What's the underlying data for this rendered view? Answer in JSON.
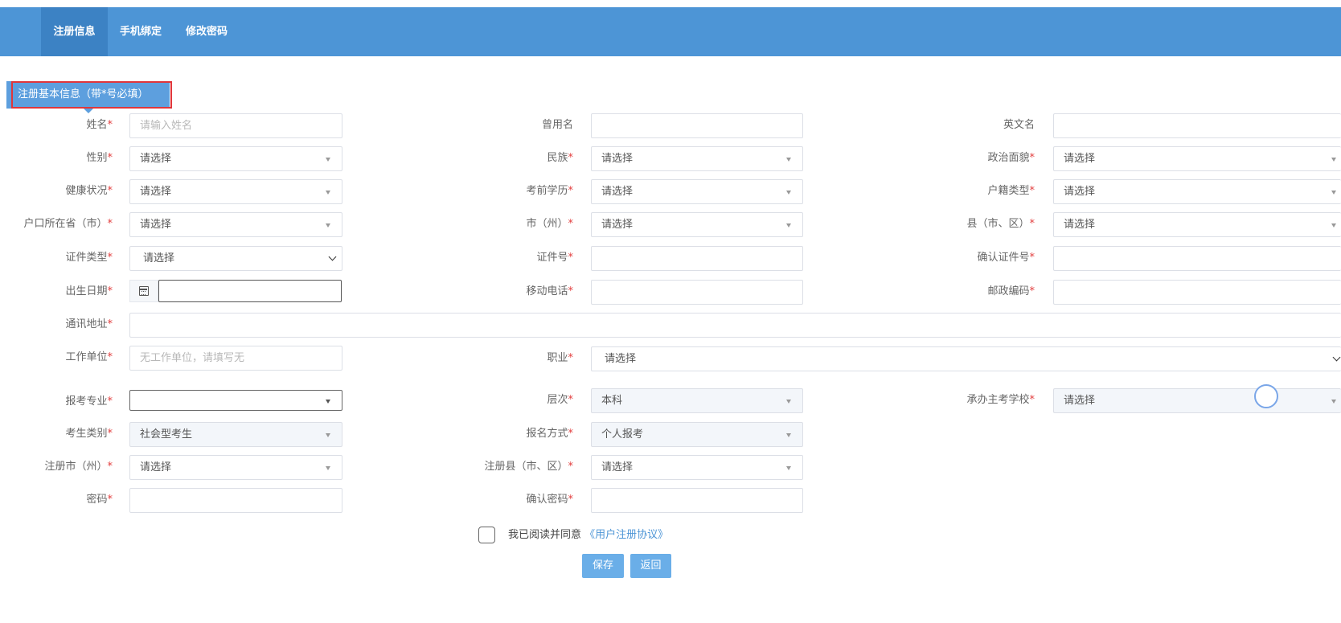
{
  "nav": {
    "tabs": [
      "注册信息",
      "手机绑定",
      "修改密码"
    ]
  },
  "section": {
    "title": "注册基本信息（带*号必填）"
  },
  "required_mark": "*",
  "fields": {
    "name": {
      "label": "姓名",
      "placeholder": "请输入姓名"
    },
    "former_name": {
      "label": "曾用名"
    },
    "english_name": {
      "label": "英文名"
    },
    "gender": {
      "label": "性别",
      "value": "请选择"
    },
    "ethnicity": {
      "label": "民族",
      "value": "请选择"
    },
    "political": {
      "label": "政治面貌",
      "value": "请选择"
    },
    "health": {
      "label": "健康状况",
      "value": "请选择"
    },
    "education": {
      "label": "考前学历",
      "value": "请选择"
    },
    "hukou_type": {
      "label": "户籍类型",
      "value": "请选择"
    },
    "hukou_province": {
      "label": "户口所在省（市）",
      "value": "请选择"
    },
    "city": {
      "label": "市（州）",
      "value": "请选择"
    },
    "county": {
      "label": "县（市、区）",
      "value": "请选择"
    },
    "id_type": {
      "label": "证件类型",
      "value": "请选择"
    },
    "id_number": {
      "label": "证件号"
    },
    "id_confirm": {
      "label": "确认证件号"
    },
    "birth_date": {
      "label": "出生日期"
    },
    "mobile": {
      "label": "移动电话"
    },
    "postcode": {
      "label": "邮政编码"
    },
    "address": {
      "label": "通讯地址"
    },
    "employer": {
      "label": "工作单位",
      "placeholder": "无工作单位，请填写无"
    },
    "occupation": {
      "label": "职业",
      "value": "请选择"
    },
    "major": {
      "label": "报考专业",
      "value": ""
    },
    "level": {
      "label": "层次",
      "value": "本科"
    },
    "host_school": {
      "label": "承办主考学校",
      "value": "请选择"
    },
    "candidate_type": {
      "label": "考生类别",
      "value": "社会型考生"
    },
    "signup_method": {
      "label": "报名方式",
      "value": "个人报考"
    },
    "reg_city": {
      "label": "注册市（州）",
      "value": "请选择"
    },
    "reg_county": {
      "label": "注册县（市、区）",
      "value": "请选择"
    },
    "password": {
      "label": "密码"
    },
    "password_confirm": {
      "label": "确认密码"
    }
  },
  "agreement": {
    "text": "我已阅读并同意",
    "link": "《用户注册协议》"
  },
  "buttons": {
    "save": "保存",
    "back": "返回"
  }
}
